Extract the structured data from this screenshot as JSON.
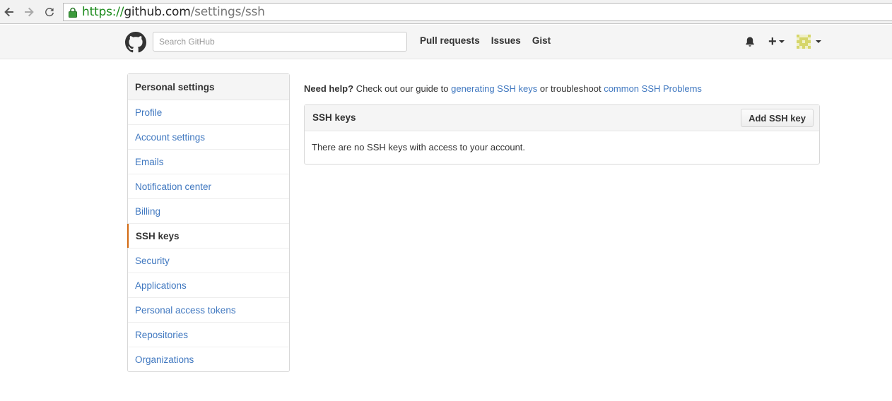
{
  "browser": {
    "url_scheme": "https://",
    "url_host": "github.com",
    "url_path": "/settings/ssh"
  },
  "header": {
    "search_placeholder": "Search GitHub",
    "nav": [
      "Pull requests",
      "Issues",
      "Gist"
    ],
    "plus_label": "+"
  },
  "sidebar": {
    "title": "Personal settings",
    "items": [
      {
        "label": "Profile"
      },
      {
        "label": "Account settings"
      },
      {
        "label": "Emails"
      },
      {
        "label": "Notification center"
      },
      {
        "label": "Billing"
      },
      {
        "label": "SSH keys",
        "selected": true
      },
      {
        "label": "Security"
      },
      {
        "label": "Applications"
      },
      {
        "label": "Personal access tokens"
      },
      {
        "label": "Repositories"
      },
      {
        "label": "Organizations"
      }
    ]
  },
  "main": {
    "help_bold": "Need help?",
    "help_text1": " Check out our guide to ",
    "help_link1": "generating SSH keys",
    "help_text2": " or troubleshoot ",
    "help_link2": "common SSH Problems",
    "panel_title": "SSH keys",
    "add_button": "Add SSH key",
    "empty_message": "There are no SSH keys with access to your account."
  },
  "colors": {
    "link": "#4078c0",
    "selected_marker": "#d26911",
    "secure_url": "#1b8a1b"
  }
}
